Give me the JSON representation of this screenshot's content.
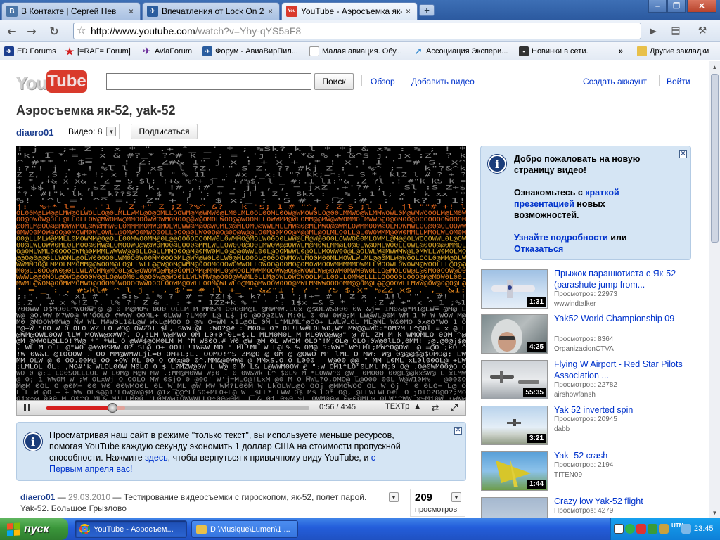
{
  "browser": {
    "tabs": [
      {
        "title": "В Контакте | Сергей Нев",
        "icon": "vk-icon",
        "color": "#4a76a8",
        "glyph": "B"
      },
      {
        "title": "Впечатления от Lock On 2",
        "icon": "lockon-icon",
        "color": "#2a5d9f",
        "glyph": "✈"
      },
      {
        "title": "YouTube - Аэросъемка як-",
        "icon": "youtube-icon",
        "color": "#d93a2c",
        "glyph": "You"
      }
    ],
    "url_host": "http://www.youtube.com",
    "url_rest": "/watch?v=Yhy-qYS5aF8",
    "bookmarks": [
      {
        "label": "ED Forums",
        "icon": "ed-icon",
        "color": "#1c3e8f"
      },
      {
        "label": "[=RAF= Forum]",
        "icon": "star-icon",
        "color": "#d21d1d"
      },
      {
        "label": "AviaForum",
        "icon": "plane-icon",
        "color": "#6a2d99"
      },
      {
        "label": "Форум - АвиаВирПил...",
        "icon": "forum-icon",
        "color": "#2a5d9f"
      },
      {
        "label": "Малая авиация. Обу...",
        "icon": "page-icon",
        "color": "#ffffff"
      },
      {
        "label": "Ассоциация Экспери...",
        "icon": "assoc-icon",
        "color": "#3d8ed1"
      },
      {
        "label": "Новинки в сети.",
        "icon": "news-icon",
        "color": "#333333"
      }
    ],
    "other_bookmarks": "Другие закладки"
  },
  "header": {
    "logo_you": "You",
    "logo_tube": "Tube",
    "search_button": "Поиск",
    "links": [
      "Обзор",
      "Добавить видео",
      "Создать аккаунт",
      "Войти"
    ]
  },
  "video": {
    "title": "Аэросъемка як-52, yak-52",
    "channel": "diaero01",
    "video_count_label": "Видео: 8",
    "subscribe": "Подписаться",
    "time": "0:56 / 4:45",
    "quality": "TEXTp",
    "progress": 0.25,
    "buffered": 0.3
  },
  "textmode_notice": {
    "line1": "Просматривая наш сайт в режиме \"только текст\", вы используете меньше ресурсов,",
    "line2": "помогая YouTube каждую секунду экономить 1 доллар США на стоимости пропускной",
    "line3a": "способности. Нажмите ",
    "link1": "здесь",
    "line3b": ", чтобы вернуться к привычному виду YouTube, и ",
    "link2a": "с",
    "link2b": "Первым апреля вас!"
  },
  "description": {
    "author": "diaero01",
    "date": "29.03.2010",
    "text": "Тестирование видеосъемки с гироскопом, як-52, полет парой.",
    "text2": "Yak-52. Большое Грызлово",
    "dash": " — ",
    "views": "209",
    "views_label": "просмотров"
  },
  "welcome": {
    "line1": "Добро пожаловать на новую",
    "line2": "страницу видео!",
    "p2a": "Ознакомьтесь с ",
    "link1a": "краткой",
    "link1b": "презентацией",
    "p2b": " новых",
    "p2c": "возможностей.",
    "link2": "Узнайте подробности",
    "or": " или",
    "link3": "Отказаться"
  },
  "related": [
    {
      "title": "Прыжок парашютиста с Як-52 (parashute jump from...",
      "views": "Просмотров: 22973",
      "channel": "wwwindtalker",
      "duration": "1:31"
    },
    {
      "title": "Yak52 World Championship 09",
      "views": "Просмотров: 8364",
      "channel": "OrganizacionCTVA",
      "duration": "4:25"
    },
    {
      "title": "Flying W Airport - Red Star Pilots Association ...",
      "views": "Просмотров: 22782",
      "channel": "airshowfansh",
      "duration": "55:35"
    },
    {
      "title": "Yak 52 inverted spin",
      "views": "Просмотров: 20945",
      "channel": "dabb",
      "duration": "3:21"
    },
    {
      "title": "Yak- 52 crash",
      "views": "Просмотров: 2194",
      "channel": "TITEN09",
      "duration": "1:44"
    },
    {
      "title": "Crazy low Yak-52 flight",
      "views": "Просмотров: 4279",
      "channel": "",
      "duration": ""
    }
  ],
  "taskbar": {
    "start": "пуск",
    "tasks": [
      "YouTube - Аэросъем...",
      "D:\\Musique\\Lumen\\1 ..."
    ],
    "clock": "23:45",
    "tray_label": "UTM"
  },
  "colors": {
    "link": "#0033cc",
    "youtube_red": "#d93a2c",
    "info_bg": "#d5e5f4"
  }
}
